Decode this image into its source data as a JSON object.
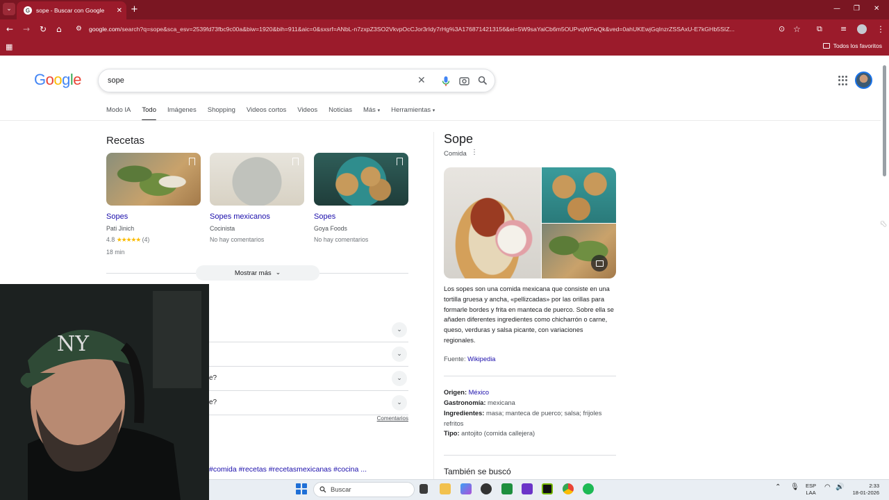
{
  "browser": {
    "tab_title": "sope - Buscar con Google",
    "url_domain": "google.com",
    "url_rest": "/search?q=sope&sca_esv=2539fd73fbc9c00a&biw=1920&bih=911&aic=0&sxsrf=ANbL-n7zxpZ3SO2VkvpOcCJor3rIdy7rHg%3A1768714213156&ei=5W9saYaiCb6m5OUPvqWFwQk&ved=0ahUKEwjGqInzrZSSAxU-E7kGHb5SIZ...",
    "bookmarks_label": "Todos los favoritos"
  },
  "google": {
    "logo": "Google",
    "query": "sope",
    "tabs": [
      "Modo IA",
      "Todo",
      "Imágenes",
      "Shopping",
      "Videos cortos",
      "Videos",
      "Noticias",
      "Más",
      "Herramientas"
    ]
  },
  "recipes": {
    "title": "Recetas",
    "items": [
      {
        "name": "Sopes",
        "source": "Pati Jinich",
        "rating": "4.8",
        "stars": "★★★★★",
        "count": "(4)",
        "time": "18 min"
      },
      {
        "name": "Sopes mexicanos",
        "source": "Cocinista",
        "meta": "No hay comentarios"
      },
      {
        "name": "Sopes",
        "source": "Goya Foods",
        "meta": "No hay comentarios"
      }
    ],
    "show_more": "Mostrar más"
  },
  "paa": {
    "questions": [
      "",
      "",
      "e?",
      "e?"
    ],
    "feedback": "Comentarios"
  },
  "hashtags": "#comida #recetas #recetasmexicanas #cocina ...",
  "knowledge_panel": {
    "title": "Sope",
    "subtitle": "Comida",
    "description": "Los sopes son una comida mexicana que consiste en una tortilla gruesa y ancha, «pellizcadas» por las orillas para formarle bordes y frita en manteca de puerco. Sobre ella se añaden diferentes ingredientes como chicharrón o carne, queso, verduras y salsa picante, con variaciones regionales.",
    "source_label": "Fuente:",
    "source_link": "Wikipedia",
    "facts": [
      {
        "label": "Origen:",
        "value": "México",
        "link": true
      },
      {
        "label": "Gastronomía:",
        "value": "mexicana",
        "link": false
      },
      {
        "label": "Ingredientes:",
        "value": "masa; manteca de puerco; salsa; frijoles refritos",
        "link": false
      },
      {
        "label": "Tipo:",
        "value": "antojito (comida callejera)",
        "link": false
      }
    ],
    "also_searched": "También se buscó"
  },
  "taskbar": {
    "search": "Buscar",
    "lang": "ESP",
    "region": "LAA",
    "time": "2:33",
    "date": "18-01-2026"
  }
}
